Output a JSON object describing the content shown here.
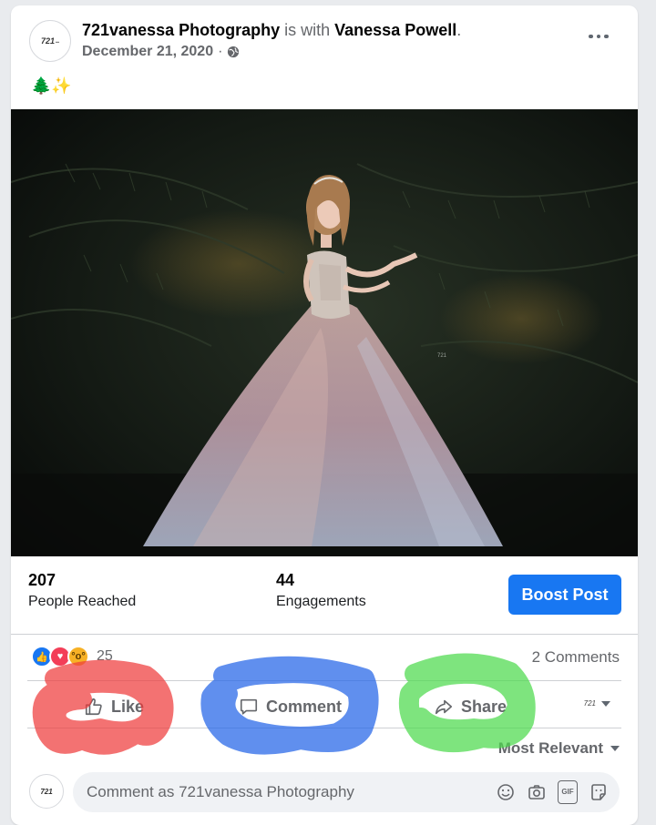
{
  "post": {
    "page_name": "721vanessa Photography",
    "with_text": "is with",
    "tagged_name": "Vanessa Powell",
    "tagged_suffix": ".",
    "date": "December 21, 2020",
    "date_separator": "·",
    "audience_icon": "globe-icon",
    "message_emojis": "🌲✨",
    "avatar_text": "721",
    "photo_watermark": "721"
  },
  "insights": {
    "reach_value": "207",
    "reach_label": "People Reached",
    "engagement_value": "44",
    "engagement_label": "Engagements",
    "boost_label": "Boost Post"
  },
  "reactions": {
    "types": [
      "like",
      "love",
      "wow"
    ],
    "count": "25",
    "comments_count": "2 Comments"
  },
  "actions": {
    "like_label": "Like",
    "comment_label": "Comment",
    "share_label": "Share",
    "page_selector_text": "721"
  },
  "comments": {
    "sort_label": "Most Relevant",
    "input_placeholder": "Comment as 721vanessa Photography",
    "icons": [
      "emoji-icon",
      "camera-icon",
      "gif-icon",
      "sticker-icon"
    ]
  },
  "colors": {
    "accent": "#1877f2",
    "love": "#f33e58",
    "wow": "#f7b125",
    "scribble_red": "#ee3b3b",
    "scribble_blue": "#2364e8",
    "scribble_green": "#4cd94c"
  }
}
